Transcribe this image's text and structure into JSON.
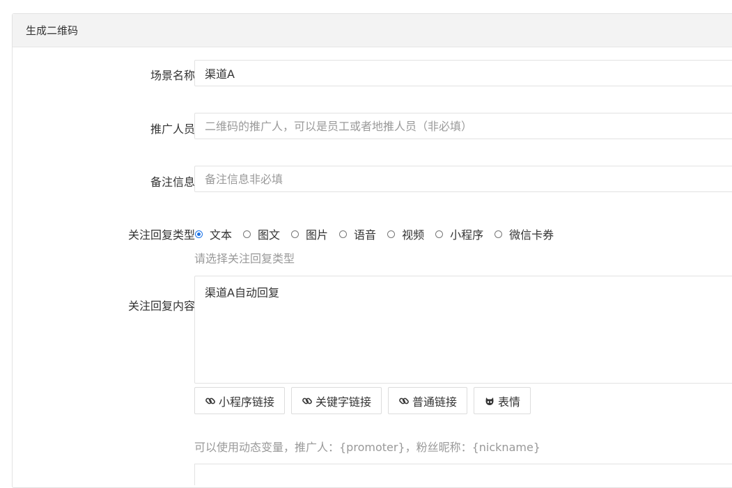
{
  "panel": {
    "title": "生成二维码"
  },
  "form": {
    "scene_name": {
      "label": "场景名称",
      "value": "渠道A"
    },
    "promoter": {
      "label": "推广人员",
      "placeholder": "二维码的推广人，可以是员工或者地推人员（非必填）"
    },
    "remark": {
      "label": "备注信息",
      "placeholder": "备注信息非必填"
    },
    "reply_type": {
      "label": "关注回复类型",
      "options": [
        "文本",
        "图文",
        "图片",
        "语音",
        "视频",
        "小程序",
        "微信卡券"
      ],
      "selected": "文本",
      "hint": "请选择关注回复类型"
    },
    "reply_content": {
      "label": "关注回复内容",
      "value": "渠道A自动回复",
      "buttons": [
        {
          "label": "小程序链接",
          "icon": "link-icon"
        },
        {
          "label": "关键字链接",
          "icon": "link-icon"
        },
        {
          "label": "普通链接",
          "icon": "link-icon"
        },
        {
          "label": "表情",
          "icon": "github-cat-icon"
        }
      ],
      "hint": "可以使用动态变量，推广人：{promoter}，粉丝昵称：{nickname}"
    }
  },
  "colors": {
    "radio_accent": "#1a73e8",
    "hint": "#999999",
    "header_bg": "#f3f3f3"
  }
}
